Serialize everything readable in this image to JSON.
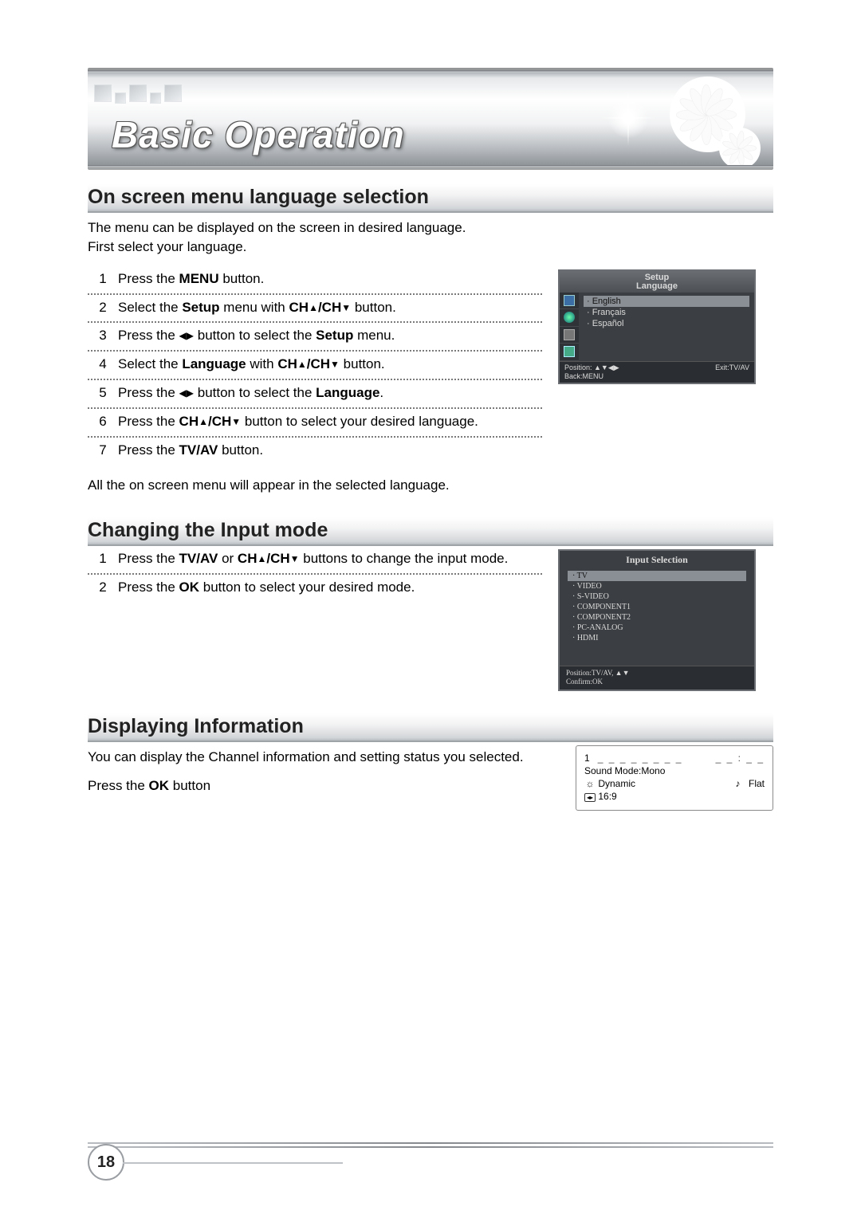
{
  "banner": {
    "title": "Basic Operation"
  },
  "section1": {
    "heading": "On screen menu language selection",
    "intro_line1": "The menu can be displayed on the screen in desired language.",
    "intro_line2": "First select your language.",
    "note": "All the on screen menu will appear in the selected language.",
    "steps": [
      {
        "n": "1",
        "html": "Press the  <b>MENU</b> button."
      },
      {
        "n": "2",
        "html": "Select the <b>Setup</b> menu with <b>CH<span class='tri'>▲</span>/CH<span class='tri'>▼</span></b> button."
      },
      {
        "n": "3",
        "html": "Press the <span class='tri'>◀▶</span> button to select the <b>Setup</b> menu."
      },
      {
        "n": "4",
        "html": "Select the <b>Language</b> with <b>CH<span class='tri'>▲</span>/CH<span class='tri'>▼</span></b> button."
      },
      {
        "n": "5",
        "html": "Press the <span class='tri'>◀▶</span> button to select the <b>Language</b>."
      },
      {
        "n": "6",
        "html": "Press the <b>CH<span class='tri'>▲</span>/CH<span class='tri'>▼</span></b> button to select your desired language."
      },
      {
        "n": "7",
        "html": "Press the <b>TV/AV</b> button."
      }
    ],
    "osd": {
      "title_line1": "Setup",
      "title_line2": "Language",
      "items": [
        "English",
        "Français",
        "Español"
      ],
      "selected": 0,
      "footer_left": "Position: ▲▼◀▶\nBack:MENU",
      "footer_right": "Exit:TV/AV"
    }
  },
  "section2": {
    "heading": "Changing the Input mode",
    "steps": [
      {
        "n": "1",
        "html": "Press the <b>TV/AV</b> or <b>CH<span class='tri'>▲</span>/CH<span class='tri'>▼</span></b> buttons to change the input mode."
      },
      {
        "n": "2",
        "html": "Press the <b>OK</b> button to select your desired mode."
      }
    ],
    "osd": {
      "title": "Input Selection",
      "items": [
        "TV",
        "VIDEO",
        "S-VIDEO",
        "COMPONENT1",
        "COMPONENT2",
        "PC-ANALOG",
        "HDMI"
      ],
      "selected": 0,
      "footer_line1": "Position:TV/AV, ▲▼",
      "footer_line2": "Confirm:OK"
    }
  },
  "section3": {
    "heading": "Displaying Information",
    "intro": "You can display the Channel information and setting status you selected.",
    "action_html": "Press the <b>OK</b> button",
    "info": {
      "channel": "1",
      "dashes_left": "_ _ _ _ _ _ _ _",
      "time_dashes": "_ _ : _ _",
      "sound_mode": "Sound Mode:Mono",
      "picture": "Dynamic",
      "sound_eq": "Flat",
      "aspect": "16:9"
    }
  },
  "page_number": "18"
}
